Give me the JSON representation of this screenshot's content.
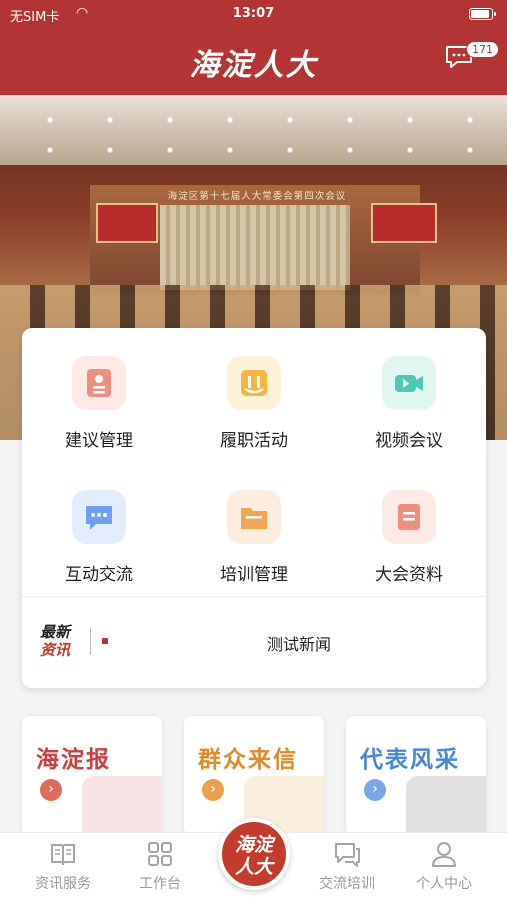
{
  "status_bar": {
    "carrier": "无SIM卡",
    "time": "13:07"
  },
  "header": {
    "title": "海淀人大",
    "message_count": "171"
  },
  "banner": {
    "sign_text": "海淀区第十七届人大常委会第四次会议"
  },
  "menu": [
    {
      "label": "建议管理",
      "icon": "proposal-doc-icon",
      "color": "#e8877a"
    },
    {
      "label": "履职活动",
      "icon": "duty-activity-icon",
      "color": "#f0b23f"
    },
    {
      "label": "视频会议",
      "icon": "video-meeting-icon",
      "color": "#4fc5b3"
    },
    {
      "label": "互动交流",
      "icon": "chat-bubble-icon",
      "color": "#6f9cf0"
    },
    {
      "label": "培训管理",
      "icon": "training-folder-icon",
      "color": "#f0a050"
    },
    {
      "label": "大会资料",
      "icon": "meeting-docs-icon",
      "color": "#e8877a"
    }
  ],
  "news": {
    "logo_top": "最新",
    "logo_bottom": "资讯",
    "headline": "测试新闻"
  },
  "features": [
    {
      "title": "海淀报",
      "color": "#c94040"
    },
    {
      "title": "群众来信",
      "color": "#e08a2a"
    },
    {
      "title": "代表风采",
      "color": "#4a86d8"
    }
  ],
  "tabbar": {
    "items": [
      {
        "label": "资讯服务",
        "icon": "book-icon"
      },
      {
        "label": "工作台",
        "icon": "grid-icon"
      },
      {
        "label": "交流培训",
        "icon": "chat-icon"
      },
      {
        "label": "个人中心",
        "icon": "person-icon"
      }
    ],
    "center_label": "海淀人大"
  }
}
